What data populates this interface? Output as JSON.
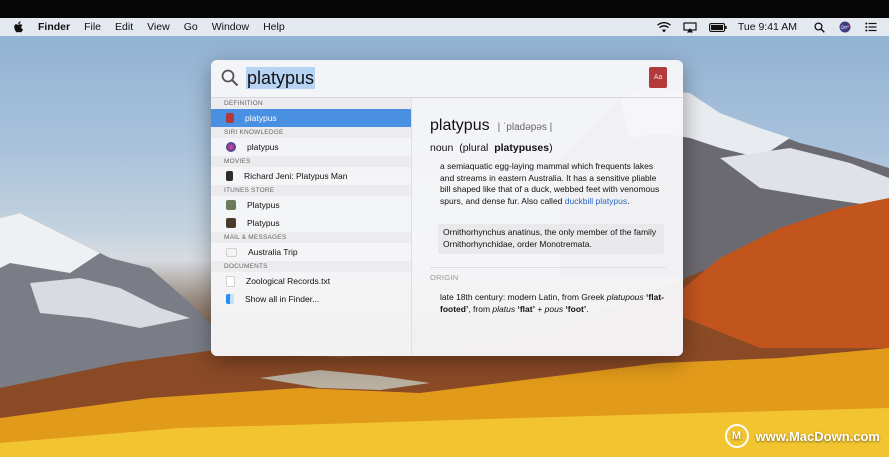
{
  "menubar": {
    "app_name": "Finder",
    "items": [
      "File",
      "Edit",
      "View",
      "Go",
      "Window",
      "Help"
    ],
    "clock": "Tue 9:41 AM",
    "status_icons": [
      "wifi-icon",
      "airplay-icon",
      "battery-icon",
      "spotlight-search-icon",
      "siri-icon",
      "notification-center-icon"
    ]
  },
  "spotlight": {
    "query": "platypus",
    "sections": [
      {
        "header": "DEFINITION",
        "items": [
          {
            "label": "platypus",
            "icon": "dictionary-icon",
            "selected": true
          }
        ]
      },
      {
        "header": "SIRI KNOWLEDGE",
        "items": [
          {
            "label": "platypus",
            "icon": "siri-knowledge-icon"
          }
        ]
      },
      {
        "header": "MOVIES",
        "items": [
          {
            "label": "Richard Jeni: Platypus Man",
            "icon": "movie-icon"
          }
        ]
      },
      {
        "header": "ITUNES STORE",
        "items": [
          {
            "label": "Platypus",
            "icon": "itunes-album-icon"
          },
          {
            "label": "Platypus",
            "icon": "itunes-album-icon"
          }
        ]
      },
      {
        "header": "MAIL & MESSAGES",
        "items": [
          {
            "label": "Australia Trip",
            "icon": "mail-icon"
          }
        ]
      },
      {
        "header": "DOCUMENTS",
        "items": [
          {
            "label": "Zoological Records.txt",
            "icon": "text-document-icon"
          }
        ]
      },
      {
        "header": "",
        "items": [
          {
            "label": "Show all in Finder...",
            "icon": "finder-icon"
          }
        ]
      }
    ],
    "preview": {
      "word": "platypus",
      "pronunciation": "| ˈpladəpəs |",
      "pos_prefix": "noun  (plural  ",
      "plural": "platypuses",
      "pos_suffix": ")",
      "definition": "a semiaquatic egg-laying mammal which frequents lakes and streams in eastern Australia. It has a sensitive pliable bill shaped like that of a duck, webbed feet with venomous spurs, and dense fur.",
      "also_called_prefix": "Also called ",
      "also_called_link": "duckbill platypus",
      "also_called_suffix": ".",
      "scientific": "Ornithorhynchus anatinus, the only member of the family Ornithorhynchidae, order Monotremata.",
      "origin_header": "ORIGIN",
      "origin_period": "late 18th century",
      "origin_text_1": ": modern Latin, from Greek ",
      "origin_word": "platupous",
      "origin_gloss": " ‘flat-footed’",
      "origin_text_2": ", from ",
      "origin_platus": "platus",
      "origin_flat": " ‘flat’",
      "origin_plus": " + ",
      "origin_pous": "pous",
      "origin_foot": " ‘foot’",
      "origin_end": "."
    }
  },
  "watermark": {
    "logo": "M",
    "text": "www.MacDown.com"
  },
  "colors": {
    "selection": "#4a90e2",
    "link": "#2a67c8",
    "highlight": "#b6d3f3"
  }
}
